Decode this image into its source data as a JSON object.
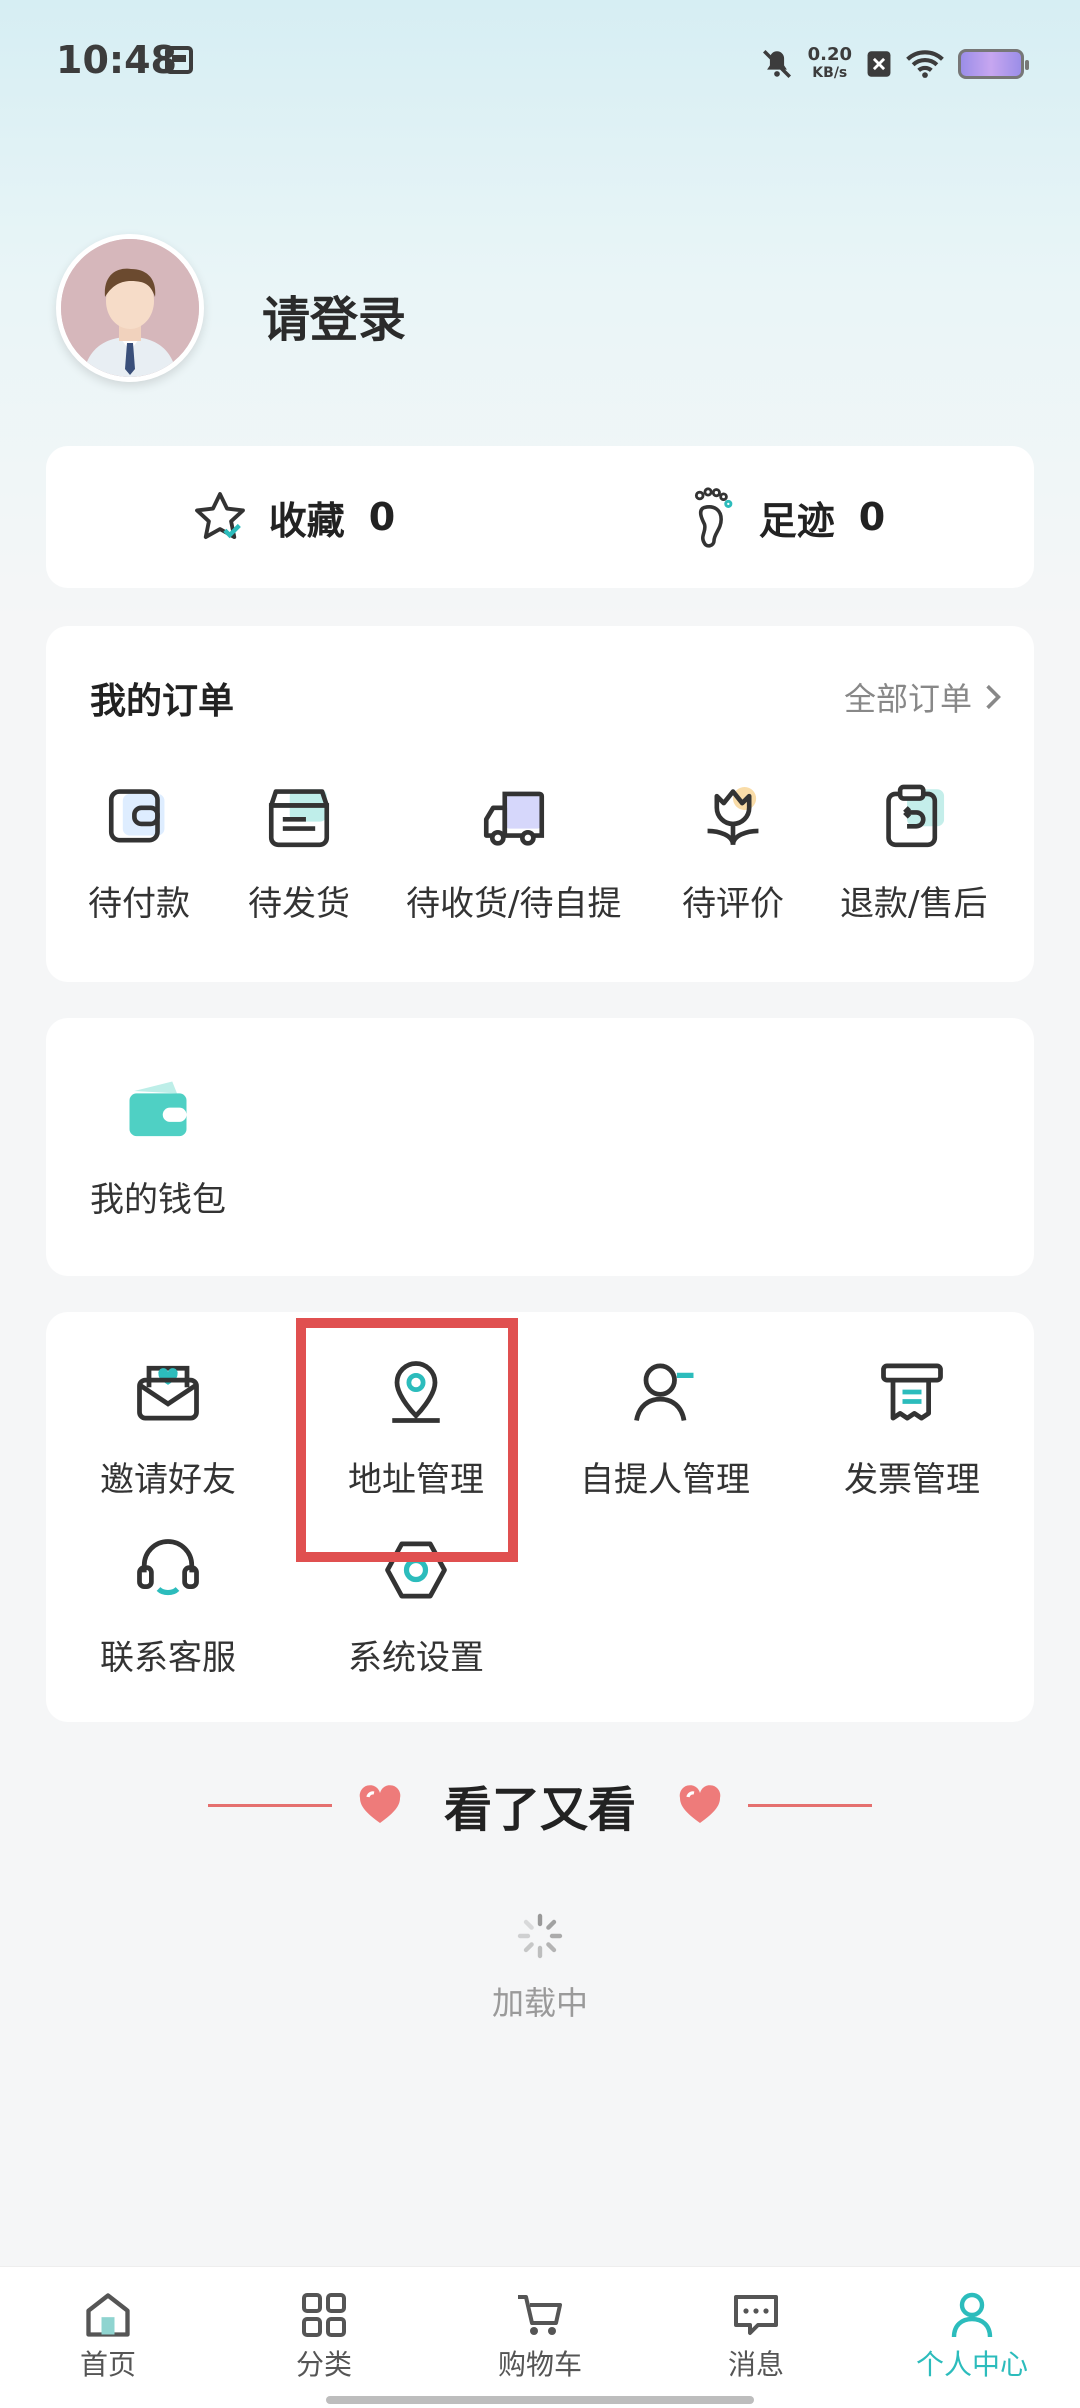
{
  "status_bar": {
    "time": "10:48",
    "speed_value": "0.20",
    "speed_unit": "KB/s"
  },
  "profile": {
    "login_text": "请登录"
  },
  "stats": {
    "favorites_label": "收藏",
    "favorites_count": "0",
    "footprints_label": "足迹",
    "footprints_count": "0"
  },
  "orders": {
    "title": "我的订单",
    "all_label": "全部订单",
    "items": [
      {
        "label": "待付款",
        "icon": "wallet-icon"
      },
      {
        "label": "待发货",
        "icon": "box-icon"
      },
      {
        "label": "待收货/待自提",
        "icon": "truck-icon"
      },
      {
        "label": "待评价",
        "icon": "flower-icon"
      },
      {
        "label": "退款/售后",
        "icon": "clipboard-return-icon"
      }
    ]
  },
  "wallet": {
    "label": "我的钱包"
  },
  "services": {
    "items": [
      {
        "label": "邀请好友",
        "icon": "envelope-heart-icon"
      },
      {
        "label": "地址管理",
        "icon": "location-pin-icon"
      },
      {
        "label": "自提人管理",
        "icon": "person-icon"
      },
      {
        "label": "发票管理",
        "icon": "invoice-icon"
      },
      {
        "label": "联系客服",
        "icon": "headset-icon"
      },
      {
        "label": "系统设置",
        "icon": "settings-icon"
      }
    ]
  },
  "recommend": {
    "title": "看了又看"
  },
  "loading": {
    "text": "加载中"
  },
  "tabbar": {
    "items": [
      {
        "label": "首页",
        "icon": "home-icon"
      },
      {
        "label": "分类",
        "icon": "grid-icon"
      },
      {
        "label": "购物车",
        "icon": "cart-icon"
      },
      {
        "label": "消息",
        "icon": "message-icon"
      },
      {
        "label": "个人中心",
        "icon": "profile-icon",
        "active": true
      }
    ]
  },
  "colors": {
    "accent": "#2cbcbc",
    "highlight": "#e05050",
    "heart": "#e5706f"
  }
}
